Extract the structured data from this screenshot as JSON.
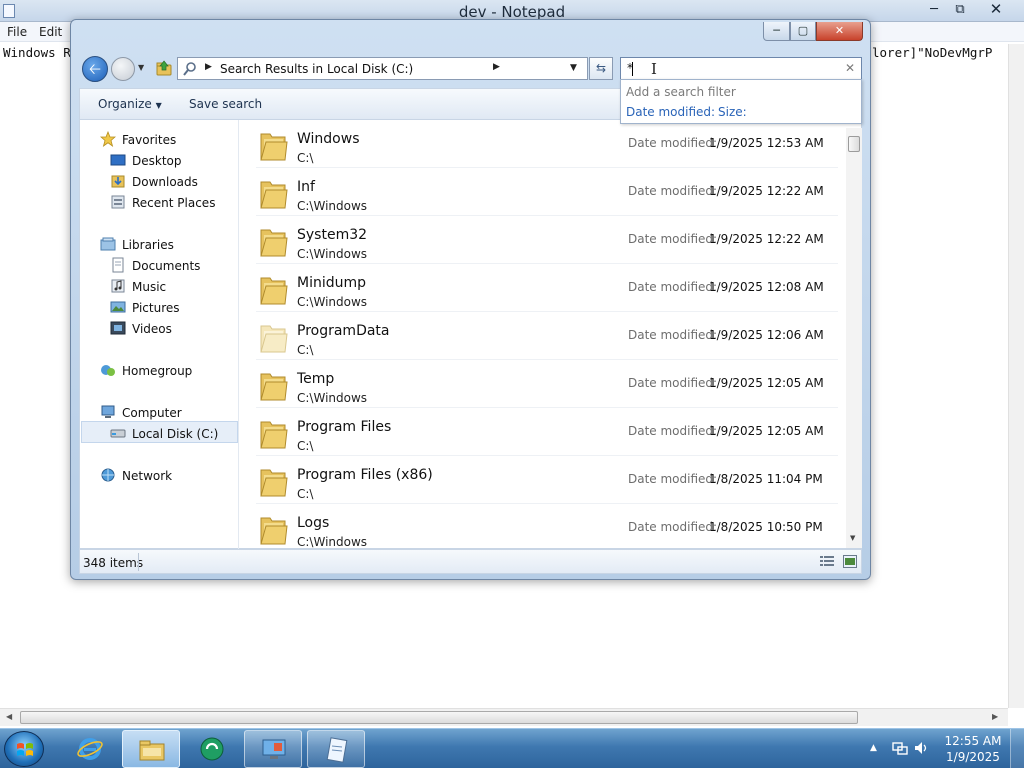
{
  "notepad": {
    "title": "dev - Notepad",
    "menus": [
      "File",
      "Edit"
    ],
    "text_left": "Windows R",
    "text_right": "lorer]\"NoDevMgrP"
  },
  "explorer": {
    "address": "Search Results in Local Disk (C:)",
    "search": {
      "value": "*",
      "filter_title": "Add a search filter",
      "filters": [
        "Date modified:",
        "Size:"
      ]
    },
    "toolbar": {
      "organize": "Organize",
      "save_search": "Save search"
    },
    "nav": {
      "favorites": "Favorites",
      "desktop": "Desktop",
      "downloads": "Downloads",
      "recent_places": "Recent Places",
      "libraries": "Libraries",
      "documents": "Documents",
      "music": "Music",
      "pictures": "Pictures",
      "videos": "Videos",
      "homegroup": "Homegroup",
      "computer": "Computer",
      "local_disk": "Local Disk (C:)",
      "network": "Network"
    },
    "date_label": "Date modified:",
    "files": [
      {
        "name": "Windows",
        "path": "C:\\",
        "date": "1/9/2025 12:53 AM"
      },
      {
        "name": "Inf",
        "path": "C:\\Windows",
        "date": "1/9/2025 12:22 AM"
      },
      {
        "name": "System32",
        "path": "C:\\Windows",
        "date": "1/9/2025 12:22 AM"
      },
      {
        "name": "Minidump",
        "path": "C:\\Windows",
        "date": "1/9/2025 12:08 AM"
      },
      {
        "name": "ProgramData",
        "path": "C:\\",
        "date": "1/9/2025 12:06 AM"
      },
      {
        "name": "Temp",
        "path": "C:\\Windows",
        "date": "1/9/2025 12:05 AM"
      },
      {
        "name": "Program Files",
        "path": "C:\\",
        "date": "1/9/2025 12:05 AM"
      },
      {
        "name": "Program Files (x86)",
        "path": "C:\\",
        "date": "1/8/2025 11:04 PM"
      },
      {
        "name": "Logs",
        "path": "C:\\Windows",
        "date": "1/8/2025 10:50 PM"
      }
    ],
    "status": {
      "count": "348 items"
    }
  },
  "taskbar": {
    "clock_time": "12:55 AM",
    "clock_date": "1/9/2025"
  },
  "colors": {
    "link": "#2a64b8",
    "taskbar": "#3f78b0",
    "close_button": "#c8422b"
  }
}
